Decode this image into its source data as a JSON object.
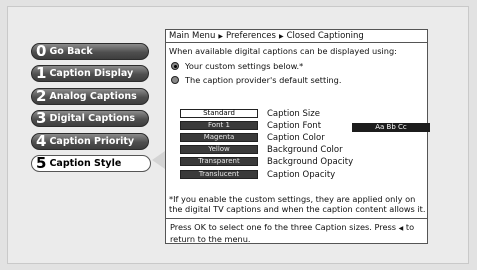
{
  "menu": {
    "items": [
      {
        "num": "0",
        "label": "Go Back"
      },
      {
        "num": "1",
        "label": "Caption Display"
      },
      {
        "num": "2",
        "label": "Analog Captions"
      },
      {
        "num": "3",
        "label": "Digital Captions"
      },
      {
        "num": "4",
        "label": "Caption Priority"
      },
      {
        "num": "5",
        "label": "Caption Style"
      }
    ],
    "selected_index": 5
  },
  "panel": {
    "breadcrumb": [
      "Main Menu",
      "Preferences",
      "Closed Captioning"
    ],
    "intro": "When available digital captions can be displayed using:",
    "options": [
      {
        "label": "Your custom settings below.*",
        "selected": true
      },
      {
        "label": "The caption provider's default setting.",
        "selected": false
      }
    ],
    "settings": [
      {
        "value": "Standard",
        "label": "Caption Size"
      },
      {
        "value": "Font 1",
        "label": "Caption Font"
      },
      {
        "value": "Magenta",
        "label": "Caption Color"
      },
      {
        "value": "Yellow",
        "label": "Background Color"
      },
      {
        "value": "Transparent",
        "label": "Background Opacity"
      },
      {
        "value": "Translucent",
        "label": "Caption Opacity"
      }
    ],
    "preview_text": "Aa Bb Cc",
    "footnote": "*If you enable the custom settings, they are applied only on the digital TV captions and when the caption content allows it.",
    "instruction_part1": "Press OK to select one fo the three Caption sizes. Press",
    "instruction_part2": "to return to the menu."
  }
}
